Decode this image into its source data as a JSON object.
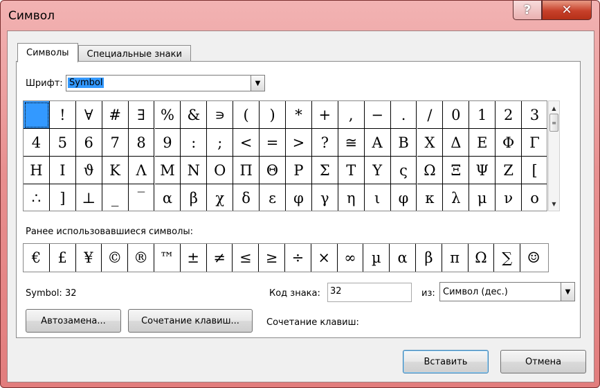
{
  "window": {
    "title": "Символ"
  },
  "titlebar": {
    "help_glyph": "?",
    "close_glyph": "✕"
  },
  "tabs": [
    {
      "label": "Символы",
      "active": true
    },
    {
      "label": "Специальные знаки",
      "active": false
    }
  ],
  "font": {
    "label": "Шрифт:",
    "value": "Symbol"
  },
  "grid": {
    "selected_index": 0,
    "columns": 20,
    "symbols": [
      " ",
      "!",
      "∀",
      "#",
      "∃",
      "%",
      "&",
      "∍",
      "(",
      ")",
      "*",
      "+",
      ",",
      "−",
      ".",
      "/",
      "0",
      "1",
      "2",
      "3",
      "4",
      "5",
      "6",
      "7",
      "8",
      "9",
      ":",
      ";",
      "<",
      "=",
      ">",
      "?",
      "≅",
      "Α",
      "Β",
      "Χ",
      "Δ",
      "Ε",
      "Φ",
      "Γ",
      "Η",
      "Ι",
      "ϑ",
      "Κ",
      "Λ",
      "Μ",
      "Ν",
      "Ο",
      "Π",
      "Θ",
      "Ρ",
      "Σ",
      "Τ",
      "Υ",
      "ς",
      "Ω",
      "Ξ",
      "Ψ",
      "Ζ",
      "[",
      "∴",
      "]",
      "⊥",
      "_",
      "‾",
      "α",
      "β",
      "χ",
      "δ",
      "ε",
      "φ",
      "γ",
      "η",
      "ι",
      "φ",
      "κ",
      "λ",
      "μ",
      "ν",
      "ο"
    ]
  },
  "recent": {
    "label": "Ранее использовавшиеся символы:",
    "symbols": [
      "€",
      "£",
      "¥",
      "©",
      "®",
      "™",
      "±",
      "≠",
      "≤",
      "≥",
      "÷",
      "×",
      "∞",
      "µ",
      "α",
      "β",
      "π",
      "Ω",
      "∑",
      "☺"
    ]
  },
  "info": {
    "symbol_desc": "Symbol: 32",
    "code_label": "Код знака:",
    "code_value": "32",
    "from_label": "из:",
    "from_value": "Символ (дес.)"
  },
  "buttons": {
    "autocorrect": "Автозамена...",
    "shortcut": "Сочетание клавиш...",
    "insert": "Вставить",
    "cancel": "Отмена"
  },
  "shortcut_label": "Сочетание клавиш:",
  "colors": {
    "selection": "#3399ff"
  }
}
